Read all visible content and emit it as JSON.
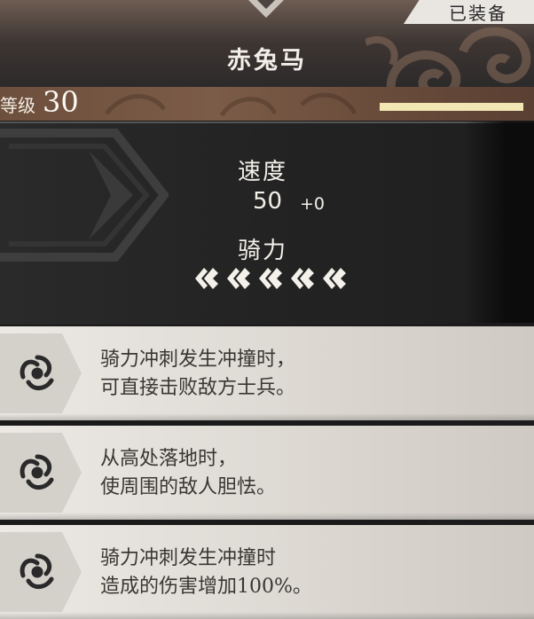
{
  "header": {
    "equip_status": "已装备",
    "title": "赤兔马"
  },
  "level": {
    "label": "等级",
    "value": "30",
    "progress": 1.0
  },
  "stats": {
    "speed_label": "速度",
    "speed_value": "50",
    "speed_bonus": "+0",
    "riding_label": "骑力",
    "riding_rating": 5
  },
  "skills": [
    {
      "line1": "骑力冲刺发生冲撞时，",
      "line2": "可直接击败敌方士兵。",
      "icon": "swirl-icon"
    },
    {
      "line1": "从高处落地时，",
      "line2": "使周围的敌人胆怯。",
      "icon": "swirl-icon"
    },
    {
      "line1": "骑力冲刺发生冲撞时",
      "line2": "造成的伤害增加100%。",
      "icon": "swirl-icon"
    }
  ],
  "colors": {
    "header_bg": "#3d3532",
    "level_strip": "#7b5c48",
    "panel_bg": "#232323",
    "skill_bg": "#e6e2dc",
    "text_light": "#f4f0ea",
    "text_dark": "#3a3633",
    "level_bar": "#f2e6b4"
  }
}
